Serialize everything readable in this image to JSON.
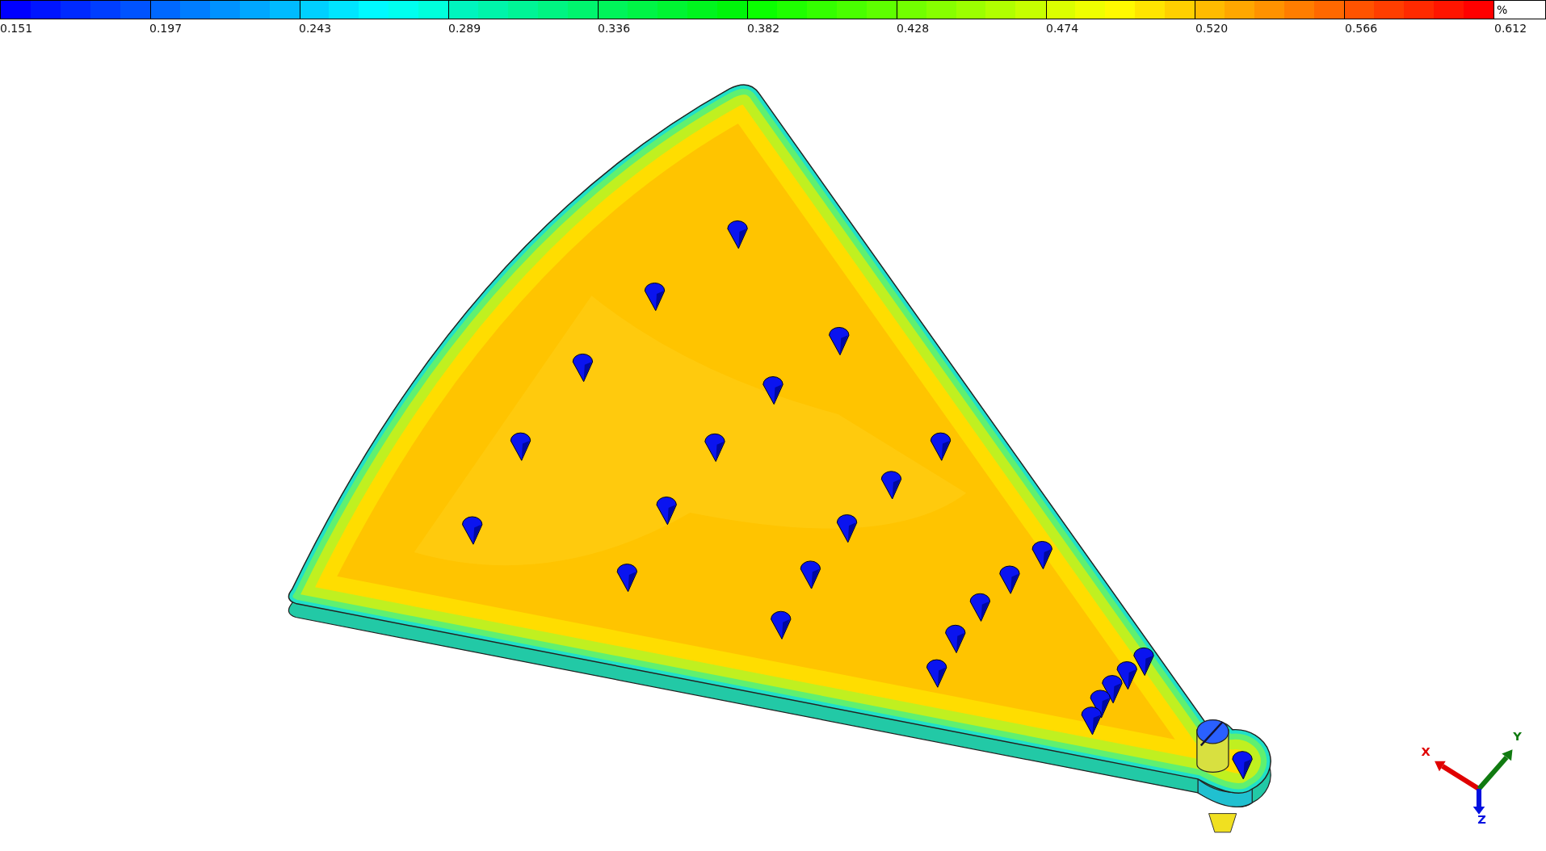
{
  "legend": {
    "unit": "%",
    "ticks": [
      "0.151",
      "0.197",
      "0.243",
      "0.289",
      "0.336",
      "0.382",
      "0.428",
      "0.474",
      "0.520",
      "0.566",
      "0.612"
    ]
  },
  "triad": {
    "axes": [
      {
        "kind": "x",
        "label": "X"
      },
      {
        "kind": "y",
        "label": "Y"
      },
      {
        "kind": "z",
        "label": "Z"
      }
    ]
  }
}
